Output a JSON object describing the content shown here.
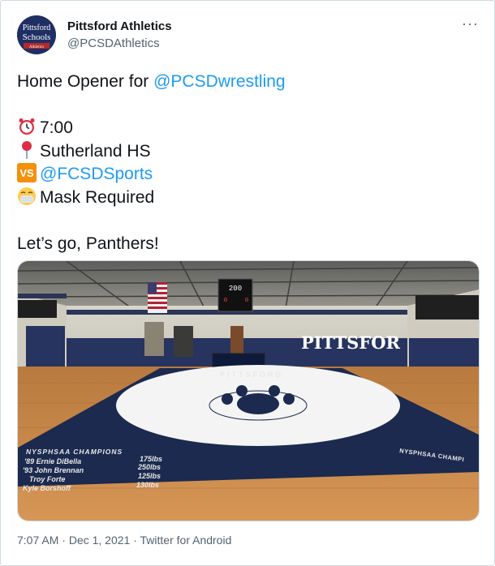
{
  "tweet": {
    "author_name": "Pittsford Athletics",
    "author_handle": "@PCSDAthletics",
    "avatar_text_line1": "Pittsford",
    "avatar_text_line2": "Schools",
    "avatar_text_line3": "Athletics",
    "more_label": "···",
    "line1_prefix": "Home Opener for ",
    "line1_mention": "@PCSDwrestling",
    "time_text": "7:00",
    "location_text": "Sutherland HS",
    "vs_mention": "@FCSDSports",
    "vs_icon_text": "VS",
    "mask_text": "Mask Required",
    "closing_text": "Let’s go, Panthers!",
    "timestamp": "7:07 AM",
    "separator1": " · ",
    "date": "Dec 1, 2021",
    "separator2": " · ",
    "source": "Twitter for Android"
  },
  "media": {
    "scoreboard_top": "200",
    "scoreboard_left": "0",
    "scoreboard_right": "0",
    "wall_text": "PITTSFOR",
    "mat_text_top": "PITTSFORD",
    "mat_text_right": "NYSPHSAA CHAMPI",
    "champions_title": "NYSPHSAA CHAMPIONS",
    "champions": [
      {
        "name": "'89 Ernie DiBella",
        "weight": "175lbs"
      },
      {
        "name": "'93 John Brennan",
        "weight": "250lbs"
      },
      {
        "name": "Troy Forte",
        "weight": "125lbs"
      },
      {
        "name": "Kyle Borshoff",
        "weight": "130lbs"
      }
    ]
  },
  "colors": {
    "mention": "#1d9bf0",
    "secondary_text": "#536471",
    "mat_navy": "#1b2a4e",
    "floor_wood": "#c98a4a"
  }
}
